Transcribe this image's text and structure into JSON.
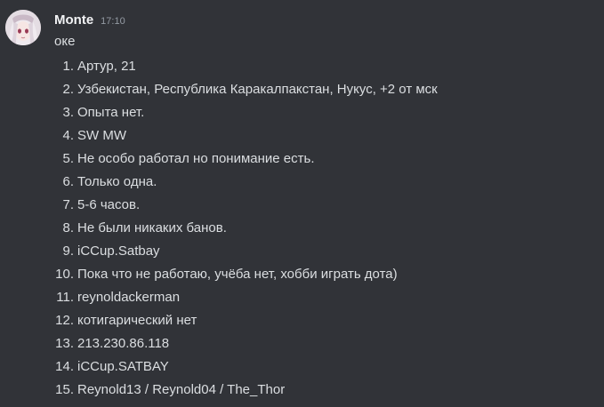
{
  "message": {
    "author": "Monte",
    "timestamp": "17:10",
    "first_line": "оке",
    "items": [
      {
        "num": "1.",
        "text": "Артур, 21"
      },
      {
        "num": "2.",
        "text": "Узбекистан, Республика Каракалпакстан, Нукус, +2 от мск"
      },
      {
        "num": "3.",
        "text": "Опыта нет."
      },
      {
        "num": "4.",
        "text": "SW MW"
      },
      {
        "num": "5.",
        "text": "Не особо работал но понимание есть."
      },
      {
        "num": "6.",
        "text": "Только одна."
      },
      {
        "num": "7.",
        "text": "5-6 часов."
      },
      {
        "num": "8.",
        "text": "Не были никаких банов."
      },
      {
        "num": "9.",
        "text": "iCCup.Satbay"
      },
      {
        "num": "10.",
        "text": "Пока что не работаю, учёба нет, хобби  играть дота)"
      },
      {
        "num": "11.",
        "text": "reynoldackerman"
      },
      {
        "num": "12.",
        "text": "котигарический нет"
      },
      {
        "num": "13.",
        "text": "213.230.86.118"
      },
      {
        "num": "14.",
        "text": "iCCup.SATBAY"
      },
      {
        "num": "15.",
        "text": "Reynold13 / Reynold04 / The_Thor"
      }
    ]
  },
  "colors": {
    "background": "#313338",
    "username": "#f2f3f5",
    "text": "#dbdee1",
    "timestamp": "#949ba4"
  }
}
